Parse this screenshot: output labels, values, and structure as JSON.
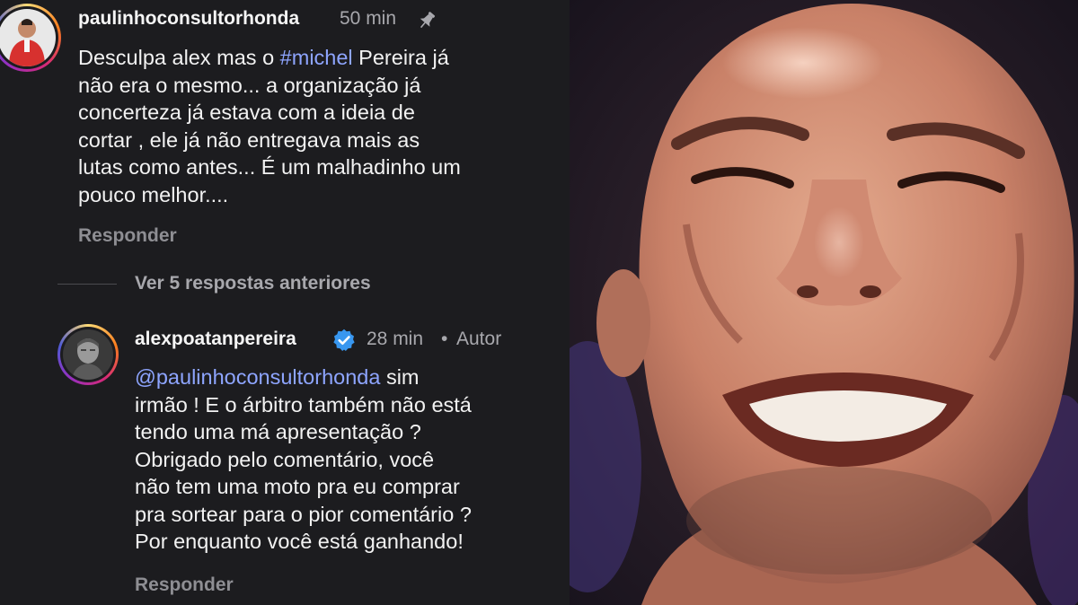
{
  "comment1": {
    "username": "paulinhoconsultorhonda",
    "time": "50 min",
    "icon": "pin-icon",
    "line1_prefix": "Desculpa alex mas o ",
    "line1_hashtag": "#michel",
    "line1_suffix": " Pereira já",
    "lines": [
      "não era o mesmo... a organização já",
      "concerteza já estava com a ideia de",
      "cortar , ele já não entregava mais as",
      "lutas como antes... É um malhadinho um",
      "pouco melhor...."
    ],
    "reply_label": "Responder"
  },
  "view_previous": "Ver 5 respostas anteriores",
  "comment2": {
    "username": "alexpoatanpereira",
    "verified_icon": "verified-badge-icon",
    "time": "28 min",
    "separator": "•",
    "author_label": "Autor",
    "mention": "@paulinhoconsultorhonda",
    "mention_suffix": " sim",
    "lines": [
      "irmão ! E o árbitro também não está",
      "tendo uma má apresentação ?",
      "Obrigado pelo comentário, você",
      "não tem uma moto pra eu comprar",
      "pra sortear para o pior comentário ?",
      "Por enquanto você está ganhando!"
    ],
    "reply_label": "Responder"
  },
  "colors": {
    "background": "#1c1c1f",
    "hashtag": "#8ea5ff",
    "verified": "#3897f0"
  }
}
